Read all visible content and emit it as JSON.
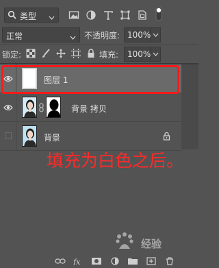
{
  "filter": {
    "kind_label": "类型",
    "icons": [
      "pixel-filter-icon",
      "adjustment-filter-icon",
      "type-filter-icon",
      "shape-filter-icon",
      "smart-object-filter-icon"
    ]
  },
  "blend": {
    "mode": "正常",
    "opacity_label": "不透明度:",
    "opacity_value": "100%"
  },
  "lock": {
    "label": "锁定:",
    "fill_label": "填充:",
    "fill_value": "100%"
  },
  "layers": [
    {
      "name": "图层 1",
      "visible": true,
      "selected": true,
      "thumbnail": "white"
    },
    {
      "name": "背景 拷贝",
      "visible": true,
      "selected": false,
      "thumbnail": "photo-with-mask"
    },
    {
      "name": "背景",
      "visible": false,
      "selected": false,
      "thumbnail": "photo",
      "locked": true
    }
  ],
  "annotation": {
    "text": "填充为白色之后。",
    "color": "#ff2a2a"
  },
  "watermark": {
    "text": "经验"
  },
  "colors": {
    "panel_bg": "#535353",
    "selected_row": "#6a6a6a",
    "highlight_box": "#ff1a1a"
  }
}
